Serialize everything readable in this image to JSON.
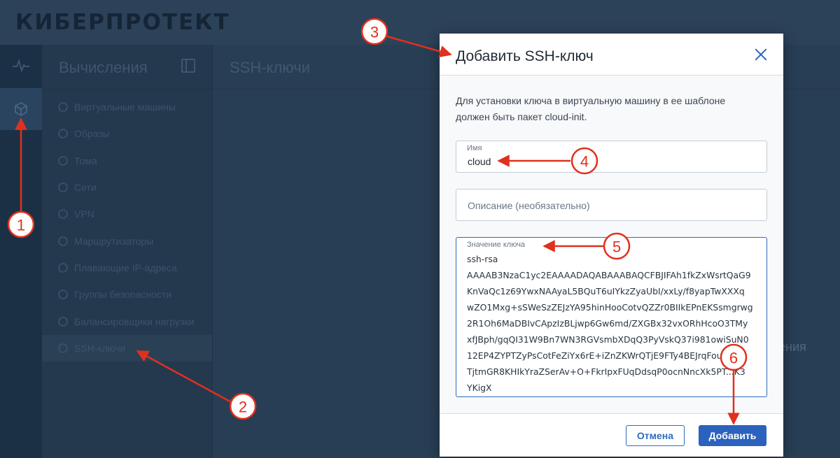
{
  "app": {
    "logo": "КИБЕРПРОТЕКТ"
  },
  "nav": {
    "title": "Вычисления",
    "items": [
      {
        "label": "Виртуальные машины",
        "icon": "cube-icon"
      },
      {
        "label": "Образы",
        "icon": "disc-icon"
      },
      {
        "label": "Тома",
        "icon": "volume-icon"
      },
      {
        "label": "Сети",
        "icon": "network-icon"
      },
      {
        "label": "VPN",
        "icon": "vpn-icon"
      },
      {
        "label": "Маршрутизаторы",
        "icon": "router-icon"
      },
      {
        "label": "Плавающие IP-адреса",
        "icon": "floating-ip-icon"
      },
      {
        "label": "Группы безопасности",
        "icon": "shield-icon"
      },
      {
        "label": "Балансировщики нагрузки",
        "icon": "balancer-icon"
      },
      {
        "label": "SSH-ключи",
        "icon": "key-icon",
        "active": true
      }
    ]
  },
  "main": {
    "title": "SSH-ключи",
    "partial_text": "жения"
  },
  "dialog": {
    "title": "Добавить SSH-ключ",
    "description": "Для установки ключа в виртуальную машину в ее шаблоне должен быть пакет cloud-init.",
    "name_label": "Имя",
    "name_value": "cloud",
    "description_placeholder": "Описание (необязательно)",
    "key_label": "Значение ключа",
    "key_value": "ssh-rsa\nAAAAB3NzaC1yc2EAAAADAQABAAABAQCFBJIFAh1fkZxWsrtQaG9\nKnVaQc1z69YwxNAAyaL5BQuT6uIYkzZyaUbI/xxLy/f8yapTwXXXq\nwZO1Mxg+sSWeSzZEJzYA95hinHooCotvQZZr0BIIkEPnEKSsmgrwg\n2R1Oh6MaDBIvCApzIzBLjwp6Gw6md/ZXGBx32vxORhHcoO3TMy\nxfJBph/gqQI31W9Bn7WN3RGVsmbXDqQ3PyVskQ37i981owiSuN0\n12EP4ZYPTZyPsCotFeZiYx6rE+iZnZKWrQTjE9FTy4BEJrqFou...lu\nTjtmGR8KHIkYraZSerAv+O+FkrIpxFUqDdsqP0ocnNncXk5PT...K3\nYKigX",
    "cancel_label": "Отмена",
    "add_label": "Добавить"
  },
  "annotations": [
    "1",
    "2",
    "3",
    "4",
    "5",
    "6"
  ],
  "colors": {
    "accent": "#2a62bd",
    "annotation": "#e0301e"
  }
}
